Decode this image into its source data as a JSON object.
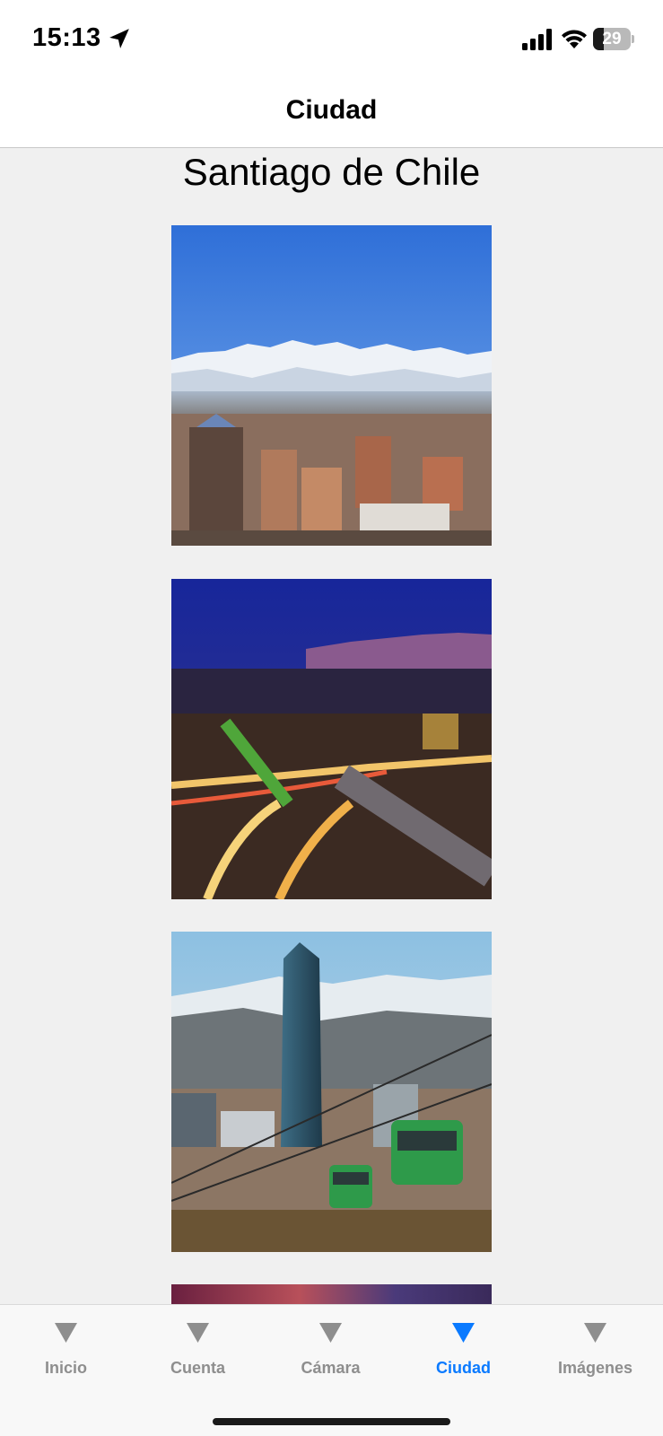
{
  "status_bar": {
    "time": "15:13",
    "battery_level": "29",
    "icons": [
      "location-arrow-icon",
      "cellular-signal-icon",
      "wifi-icon",
      "battery-icon"
    ]
  },
  "nav": {
    "title": "Ciudad"
  },
  "content": {
    "city_title": "Santiago de Chile",
    "photos": [
      {
        "subject": "Santiago skyline with snow-capped Andes under blue sky"
      },
      {
        "subject": "Santiago at dusk with highways and city lights"
      },
      {
        "subject": "Gran Torre Santiago with green cable cars and Andes"
      },
      {
        "subject": "Partially visible photo with red-purple sky"
      }
    ]
  },
  "tabs": [
    {
      "label": "Inicio",
      "active": false
    },
    {
      "label": "Cuenta",
      "active": false
    },
    {
      "label": "Cámara",
      "active": false
    },
    {
      "label": "Ciudad",
      "active": true
    },
    {
      "label": "Imágenes",
      "active": false
    }
  ],
  "colors": {
    "active_tab": "#0a7aff",
    "inactive_tab": "#8e8e8e",
    "content_background": "#f0f0f0"
  }
}
